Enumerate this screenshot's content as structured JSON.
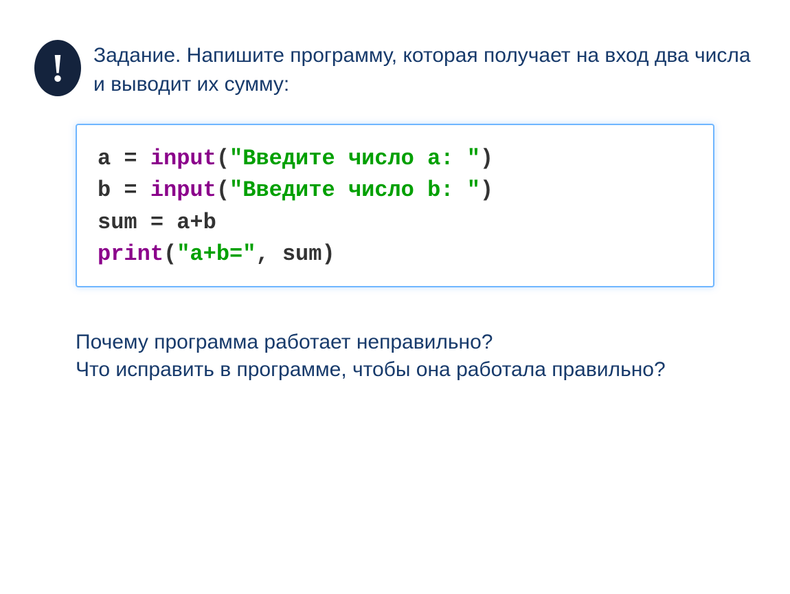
{
  "header": {
    "badge_text": "!",
    "task_text": "Задание. Напишите программу, которая получает на вход два числа и выводит их сумму:"
  },
  "code": {
    "l1_a": "a",
    "l1_eq": " = ",
    "l1_fn": "input",
    "l1_p1": "(",
    "l1_str": "\"Введите число a: \"",
    "l1_p2": ")",
    "l2_b": "b",
    "l2_eq": " = ",
    "l2_fn": "input",
    "l2_p1": "(",
    "l2_str": "\"Введите число b: \"",
    "l2_p2": ")",
    "l3": "sum = a+b",
    "l4_fn": "print",
    "l4_p1": "(",
    "l4_str": "\"a+b=\"",
    "l4_rest": ", sum)"
  },
  "questions": {
    "q1": "Почему программа работает неправильно?",
    "q2": "Что исправить в программе, чтобы она работала правильно?"
  }
}
